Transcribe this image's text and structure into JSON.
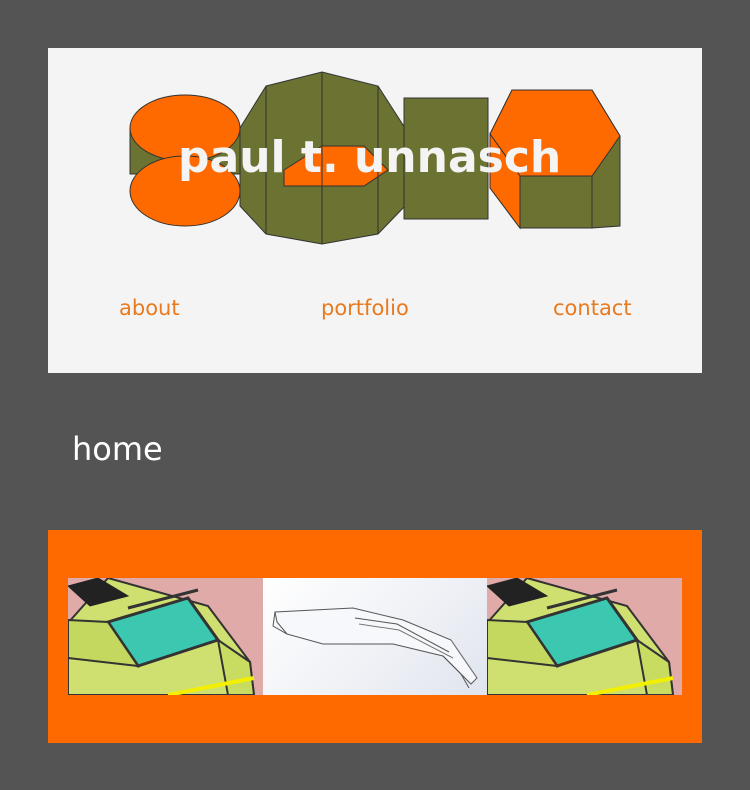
{
  "site": {
    "title": "paul t. unnasch",
    "colors": {
      "background": "#545454",
      "header_bg": "#f4f4f4",
      "accent": "#ff6a00",
      "shape_olive": "#6b7232",
      "nav_text": "#e87a1f"
    }
  },
  "nav": {
    "items": [
      {
        "label": "about"
      },
      {
        "label": "portfolio"
      },
      {
        "label": "contact"
      }
    ]
  },
  "page": {
    "title": "home"
  },
  "gallery": {
    "images": [
      {
        "icon": "car-render-image"
      },
      {
        "icon": "cad-wireframe-image"
      },
      {
        "icon": "car-render-image"
      }
    ]
  }
}
